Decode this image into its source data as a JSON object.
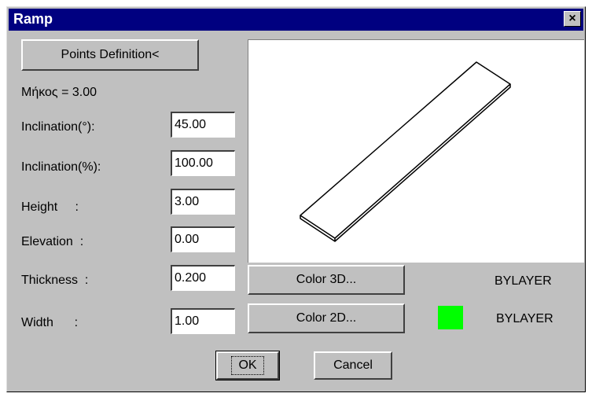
{
  "window": {
    "title": "Ramp",
    "close_glyph": "×"
  },
  "points_button": "Points Definition<",
  "length_text": "Μήκος = 3.00",
  "fields": {
    "inclination_deg": {
      "label": "Inclination(°):",
      "value": "45.00"
    },
    "inclination_pct": {
      "label": "Inclination(%):",
      "value": "100.00"
    },
    "height": {
      "label": "Height     :",
      "value": "3.00"
    },
    "elevation": {
      "label": "Elevation  :",
      "value": "0.00"
    },
    "thickness": {
      "label": "Thickness  :",
      "value": "0.200"
    },
    "width": {
      "label": "Width      :",
      "value": "1.00"
    }
  },
  "color3d": {
    "button": "Color 3D...",
    "layer": "BYLAYER"
  },
  "color2d": {
    "button": "Color 2D...",
    "layer": "BYLAYER",
    "swatch": "#00ff00"
  },
  "ok_button": "OK",
  "cancel_button": "Cancel"
}
